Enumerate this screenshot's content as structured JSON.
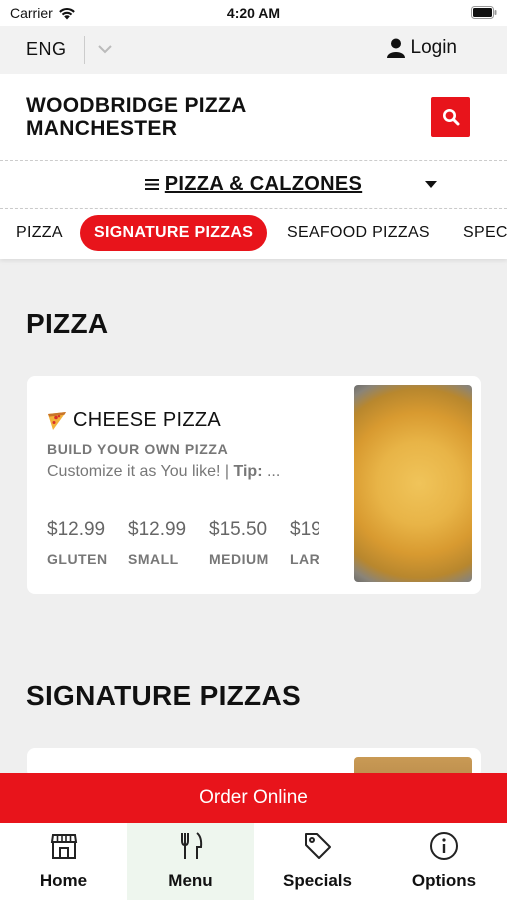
{
  "status_bar": {
    "carrier": "Carrier",
    "time": "4:20 AM"
  },
  "top_bar": {
    "language": "ENG",
    "login_label": "Login"
  },
  "header": {
    "brand_line1": "WOODBRIDGE PIZZA",
    "brand_line2": "MANCHESTER"
  },
  "category": {
    "label": "PIZZA & CALZONES",
    "prefix_icon": "hamburger-menu-icon"
  },
  "tabs": [
    {
      "label": "PIZZA"
    },
    {
      "label": "SIGNATURE PIZZAS",
      "active": true
    },
    {
      "label": "SEAFOOD PIZZAS"
    },
    {
      "label": "SPEC"
    }
  ],
  "sections": [
    {
      "title": "PIZZA",
      "items": [
        {
          "name": "CHEESE PIZZA",
          "icon": "pizza-slice-icon",
          "subtitle": "BUILD YOUR OWN PIZZA",
          "description": "Customize it as You like!",
          "tip_label": "Tip:",
          "tip_text": "...",
          "prices": [
            {
              "amount": "$12.99",
              "label": "GLUTEN"
            },
            {
              "amount": "$12.99",
              "label": "SMALL"
            },
            {
              "amount": "$15.50",
              "label": "MEDIUM"
            },
            {
              "amount": "$19",
              "label": "LAR"
            }
          ]
        }
      ]
    },
    {
      "title": "SIGNATURE PIZZAS"
    }
  ],
  "order_button": {
    "label": "Order Online"
  },
  "bottom_nav": [
    {
      "label": "Home",
      "icon": "store-icon"
    },
    {
      "label": "Menu",
      "icon": "fork-knife-icon",
      "active": true
    },
    {
      "label": "Specials",
      "icon": "tag-icon"
    },
    {
      "label": "Options",
      "icon": "info-icon"
    }
  ],
  "colors": {
    "accent": "#e8141b",
    "active_nav_bg": "#eef6ee",
    "page_bg": "#efefef"
  }
}
